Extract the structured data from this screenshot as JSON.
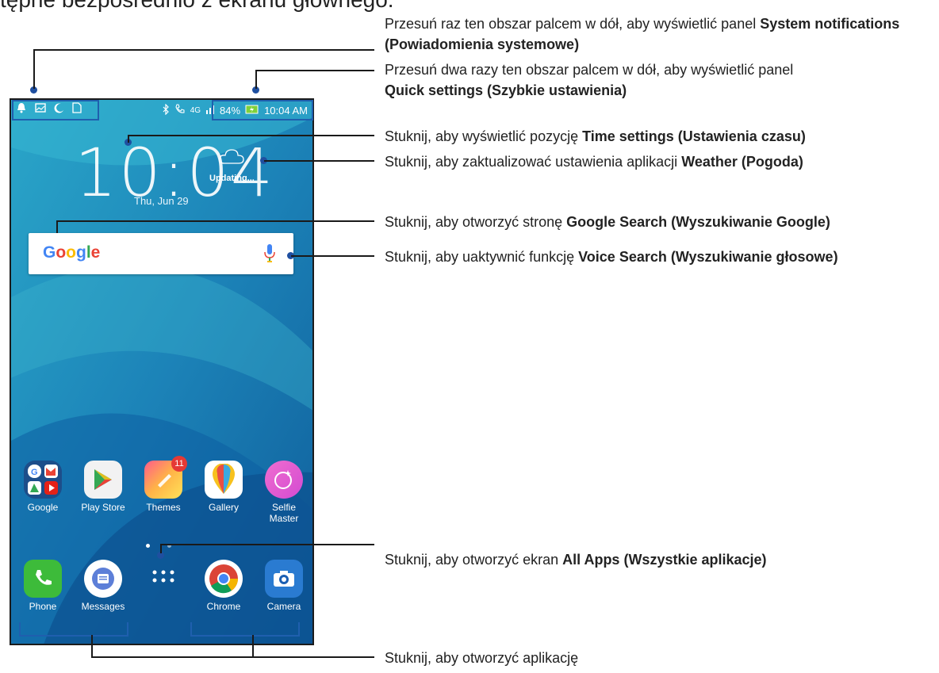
{
  "page": {
    "top_partial_text": "tępne bezpośrednio z ekranu głównego."
  },
  "phone": {
    "status": {
      "battery": "84%",
      "time": "10:04 AM",
      "network": "4G"
    },
    "clock": "10:04",
    "date": "Thu, Jun 29",
    "weather_status": "Updating...",
    "search": {
      "logo": "Google"
    },
    "home_apps": [
      {
        "label": "Google",
        "icon": "google-folder-icon"
      },
      {
        "label": "Play Store",
        "icon": "play-store-icon"
      },
      {
        "label": "Themes",
        "icon": "themes-icon",
        "badge": "11"
      },
      {
        "label": "Gallery",
        "icon": "gallery-icon"
      },
      {
        "label": "Selfie Master",
        "label_line1": "Selfie",
        "label_line2": "Master",
        "icon": "selfie-master-icon"
      }
    ],
    "dock_apps": [
      {
        "label": "Phone",
        "icon": "phone-icon"
      },
      {
        "label": "Messages",
        "icon": "messages-icon"
      },
      {
        "label": "",
        "icon": "all-apps-icon"
      },
      {
        "label": "Chrome",
        "icon": "chrome-icon"
      },
      {
        "label": "Camera",
        "icon": "camera-icon"
      }
    ]
  },
  "annotations": {
    "notifications": {
      "pre": "Przesuń raz ten obszar palcem w dół, aby wyświetlić panel ",
      "bold": "System notifications (Powiadomienia systemowe)"
    },
    "quick": {
      "pre": "Przesuń dwa razy ten obszar palcem w dół, aby wyświetlić panel ",
      "bold": "Quick settings (Szybkie ustawienia)"
    },
    "time": {
      "pre": "Stuknij, aby wyświetlić pozycję ",
      "bold": "Time settings (Ustawienia czasu)"
    },
    "weather": {
      "pre": "Stuknij, aby zaktualizować ustawienia aplikacji ",
      "bold": "Weather (Pogoda)"
    },
    "google": {
      "pre": "Stuknij, aby otworzyć stronę ",
      "bold": "Google Search (Wyszukiwanie Google)"
    },
    "voice": {
      "pre": "Stuknij, aby uaktywnić funkcję ",
      "bold": "Voice Search (Wyszukiwanie głosowe)"
    },
    "allapps": {
      "pre": "Stuknij, aby otworzyć ekran ",
      "bold": "All Apps (Wszystkie aplikacje)"
    },
    "openapp": {
      "text": "Stuknij, aby otworzyć aplikację"
    }
  },
  "colors": {
    "callout_point": "#1f4fa0",
    "callout_bracket": "#1f5fae",
    "badge": "#e53935"
  }
}
